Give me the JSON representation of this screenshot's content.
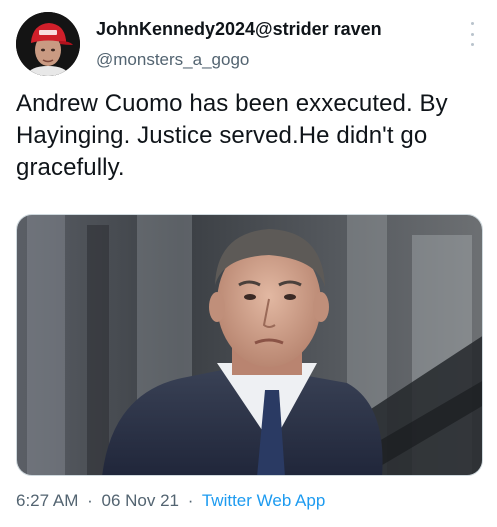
{
  "author": {
    "display_name": "JohnKennedy2024@strider raven",
    "handle": "@monsters_a_gogo"
  },
  "tweet": {
    "text": "Andrew Cuomo has been exxecuted. By Hayinging. Justice served.He didn't go gracefully."
  },
  "meta": {
    "time": "6:27 AM",
    "separator": "·",
    "date": "06 Nov 21",
    "source": "Twitter Web App"
  },
  "icons": {
    "more": "more-vertical-icon"
  },
  "colors": {
    "text": "#0f1419",
    "secondary": "#536471",
    "link": "#1d9bf0"
  }
}
